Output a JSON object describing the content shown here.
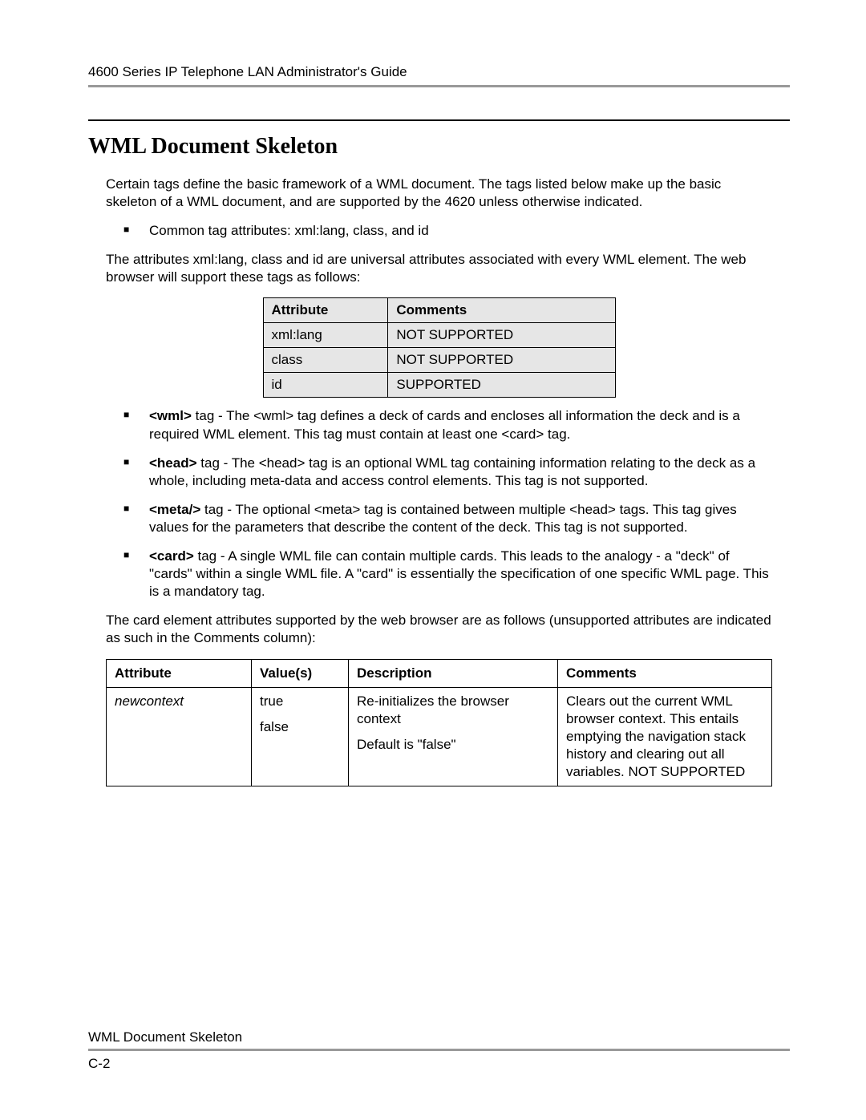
{
  "header": {
    "title": "4600 Series IP Telephone LAN Administrator's Guide"
  },
  "section": {
    "title": "WML Document Skeleton",
    "intro": "Certain tags define the basic framework of a WML document. The tags listed below make up the basic skeleton of a WML document, and are supported by the 4620 unless otherwise indicated.",
    "bullet_common": "Common tag attributes: xml:lang, class, and id",
    "attr_para": "The attributes xml:lang, class and id are universal attributes associated with every WML element. The web browser will support these tags as follows:"
  },
  "attr_table": {
    "headers": {
      "attribute": "Attribute",
      "comments": "Comments"
    },
    "rows": [
      {
        "attribute": "xml:lang",
        "comments": "NOT SUPPORTED"
      },
      {
        "attribute": "class",
        "comments": "NOT SUPPORTED"
      },
      {
        "attribute": "id",
        "comments": "SUPPORTED"
      }
    ]
  },
  "tags": {
    "wml": {
      "label": "<wml>",
      "text": " tag - The <wml> tag defines a deck of cards and encloses all information the deck and is a required WML element. This tag must contain at least one <card> tag."
    },
    "head": {
      "label": "<head>",
      "text": " tag - The <head> tag is an optional WML tag containing information relating to the deck as a whole, including meta-data and access control elements. This tag is not supported."
    },
    "meta": {
      "label": "<meta/>",
      "text": " tag - The optional <meta> tag is contained between multiple <head> tags. This tag gives values for the parameters that describe the content of the deck. This tag is not supported."
    },
    "card": {
      "label": "<card>",
      "text": " tag - A single WML file can contain multiple cards. This leads to the analogy - a \"deck\" of \"cards\" within a single WML file. A \"card\" is essentially the specification of one specific WML page. This is a mandatory tag."
    }
  },
  "card_intro": "The card element attributes supported by the web browser are as follows (unsupported attributes are indicated as such in the Comments column):",
  "card_table": {
    "headers": {
      "attribute": "Attribute",
      "values": "Value(s)",
      "description": "Description",
      "comments": "Comments"
    },
    "row": {
      "attribute": "newcontext",
      "value1": "true",
      "value2": "false",
      "desc1": "Re-initializes the browser context",
      "desc2": "Default is \"false\"",
      "comments": "Clears out the current WML browser context. This entails emptying the navigation stack history and clearing out all variables. NOT SUPPORTED"
    }
  },
  "footer": {
    "title": "WML Document Skeleton",
    "page": "C-2"
  }
}
